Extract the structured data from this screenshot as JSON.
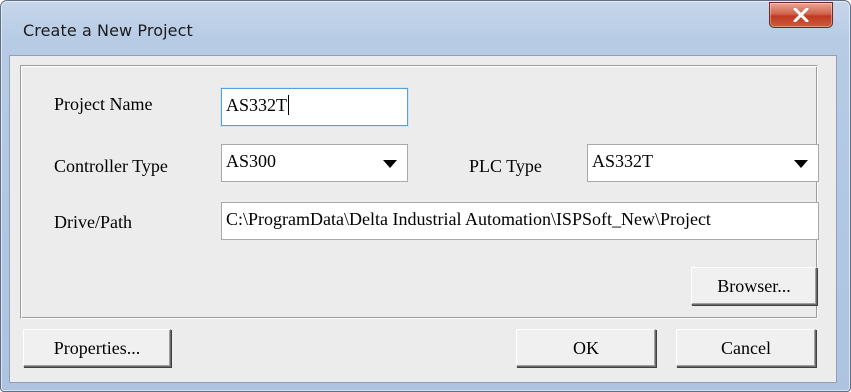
{
  "window": {
    "title": "Create a New Project",
    "close_icon": "close-x-icon"
  },
  "form": {
    "project_name": {
      "label": "Project Name",
      "value": "AS332T"
    },
    "controller_type": {
      "label": "Controller Type",
      "value": "AS300"
    },
    "plc_type": {
      "label": "PLC Type",
      "value": "AS332T"
    },
    "drive_path": {
      "label": "Drive/Path",
      "value": "C:\\ProgramData\\Delta Industrial Automation\\ISPSoft_New\\Project"
    }
  },
  "buttons": {
    "browser": "Browser...",
    "properties": "Properties...",
    "ok": "OK",
    "cancel": "Cancel"
  },
  "colors": {
    "frame": "#b7cbe5",
    "close_button": "#c9482c",
    "client_background": "#ececec",
    "focus_border": "#5aa0d8"
  }
}
